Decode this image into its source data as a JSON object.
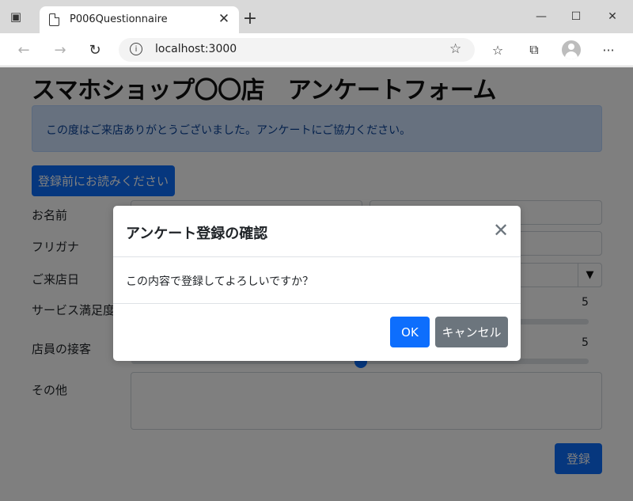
{
  "browser": {
    "tab_title": "P006Questionnaire",
    "url": "localhost:3000",
    "icons": {
      "window": "window-icon",
      "page": "page-icon",
      "close": "close-icon",
      "new_tab": "plus-icon",
      "back": "arrow-left-icon",
      "forward": "arrow-right-icon",
      "reload": "reload-icon",
      "info": "info-icon",
      "favorite": "star-plus-icon",
      "favorites": "favorites-icon",
      "collections": "collections-icon",
      "profile": "profile-icon",
      "menu": "more-icon"
    },
    "glyphs": {
      "close": "✕",
      "new_tab": "+",
      "back": "←",
      "forward": "→",
      "reload": "↻",
      "info": "i",
      "favorite": "☆",
      "favorites": "☆",
      "collections": "⧉",
      "menu": "···",
      "minimize": "—",
      "maximize": "☐",
      "win_close": "✕"
    }
  },
  "page": {
    "title": "スマホショップ〇〇店　アンケートフォーム",
    "alert": "この度はご来店ありがとうございました。アンケートにご協力ください。",
    "read_first_button": "登録前にお読みください",
    "fields": {
      "name_label": "お名前",
      "furigana_label": "フリガナ",
      "visit_date_label": "ご来店日",
      "service_label": "サービス満足度",
      "service_value": "5",
      "staff_label": "店員の接客",
      "staff_value": "5",
      "other_label": "その他"
    },
    "select_arrow": "▼",
    "submit_button": "登録"
  },
  "modal": {
    "title": "アンケート登録の確認",
    "close_glyph": "✕",
    "body": "この内容で登録してよろしいですか？",
    "ok_button": "OK",
    "cancel_button": "キャンセル"
  },
  "colors": {
    "primary": "#0d6efd",
    "secondary": "#6c757d",
    "alert_bg": "#cfe2ff",
    "alert_text": "#084298"
  }
}
